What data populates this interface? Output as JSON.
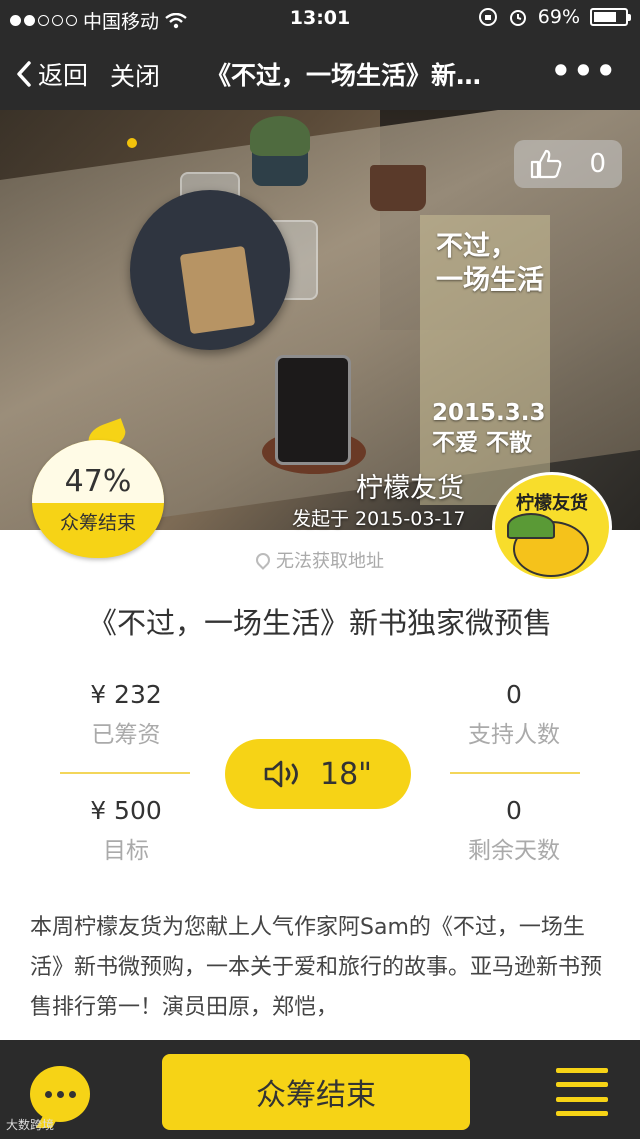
{
  "status_bar": {
    "carrier": "中国移动",
    "time": "13:01",
    "battery": "69%"
  },
  "nav": {
    "back_label": "返回",
    "close_label": "关闭",
    "title": "《不过，一场生活》新…",
    "more_label": "•••"
  },
  "hero": {
    "like_count": "0",
    "book_title_line1": "不过，",
    "book_title_line2": "一场生活",
    "book_date_line1": "2015.3.3",
    "book_date_line2": "不爱 不散",
    "organizer": "柠檬友货",
    "started": "发起于 2015-03-17",
    "progress_percent": "47%",
    "progress_value": 0.47,
    "progress_status": "众筹结束",
    "logo_text": "柠檬友货"
  },
  "location": "无法获取地址",
  "project_title": "《不过，一场生活》新书独家微预售",
  "stats": {
    "raised_value": "¥ 232",
    "raised_label": "已筹资",
    "backers_value": "0",
    "backers_label": "支持人数",
    "goal_value": "¥ 500",
    "goal_label": "目标",
    "days_value": "0",
    "days_label": "剩余天数"
  },
  "voice_duration": "18\"",
  "description": "本周柠檬友货为您献上人气作家阿Sam的《不过，一场生活》新书微预购，一本关于爱和旅行的故事。亚马逊新书预售排行第一！演员田原，郑恺，",
  "bottom": {
    "main_button": "众筹结束"
  },
  "watermark": "大数跨境",
  "colors": {
    "accent": "#f6d316",
    "dark_bar": "#2b2b2b"
  }
}
